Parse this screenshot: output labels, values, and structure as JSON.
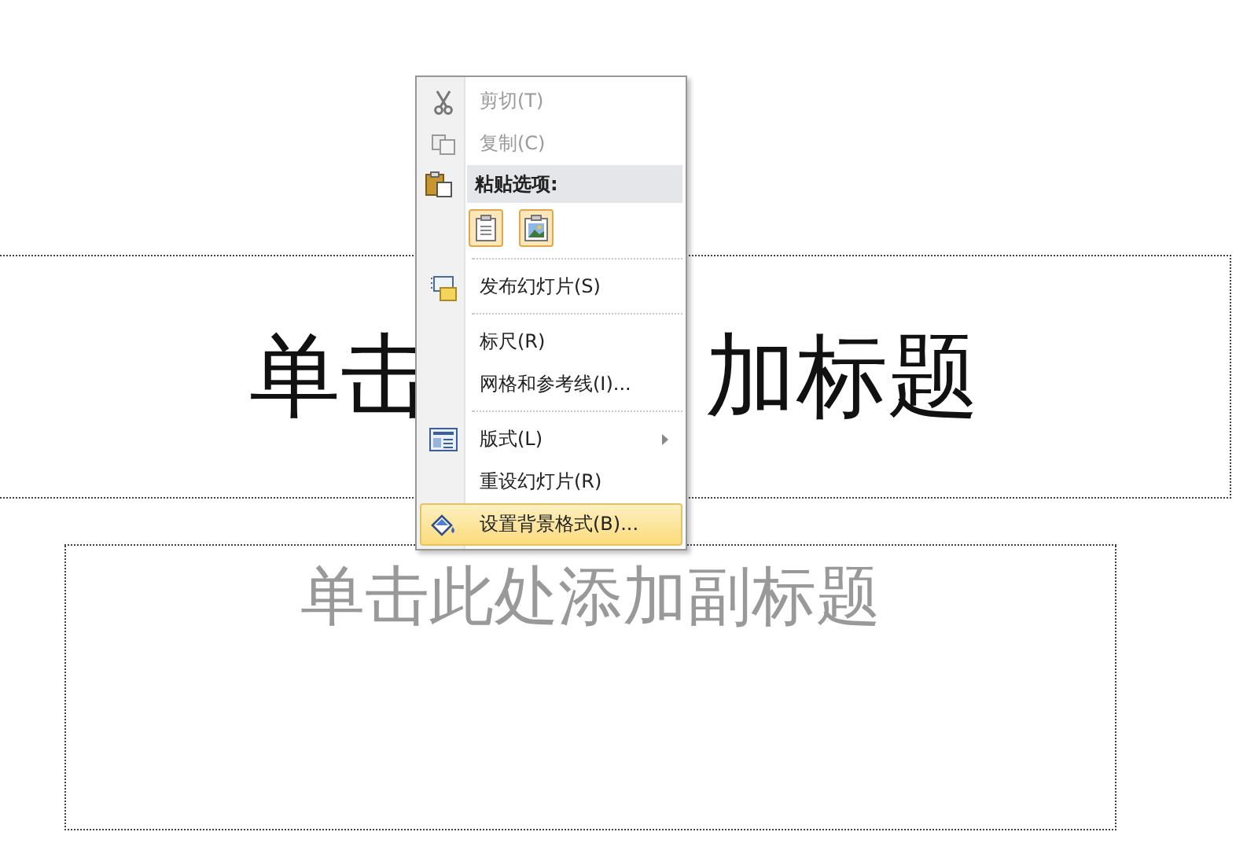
{
  "title_placeholder": {
    "visible_parts": [
      "单击",
      "加标题"
    ]
  },
  "subtitle_placeholder": {
    "text": "单击此处添加副标题"
  },
  "context_menu": {
    "items": [
      {
        "kind": "item",
        "label": "剪切(T)",
        "disabled": true,
        "selected": false,
        "submenu": false
      },
      {
        "kind": "item",
        "label": "复制(C)",
        "disabled": true,
        "selected": false,
        "submenu": false
      },
      {
        "kind": "header",
        "label": "粘贴选项:"
      },
      {
        "kind": "paste_options"
      },
      {
        "kind": "separator"
      },
      {
        "kind": "item",
        "label": "发布幻灯片(S)",
        "disabled": false,
        "selected": false,
        "submenu": false
      },
      {
        "kind": "separator"
      },
      {
        "kind": "item",
        "label": "标尺(R)",
        "disabled": false,
        "selected": false,
        "submenu": false
      },
      {
        "kind": "item",
        "label": "网格和参考线(I)...",
        "disabled": false,
        "selected": false,
        "submenu": false
      },
      {
        "kind": "separator"
      },
      {
        "kind": "item",
        "label": "版式(L)",
        "disabled": false,
        "selected": false,
        "submenu": true
      },
      {
        "kind": "item",
        "label": "重设幻灯片(R)",
        "disabled": false,
        "selected": false,
        "submenu": false
      },
      {
        "kind": "item",
        "label": "设置背景格式(B)...",
        "disabled": false,
        "selected": true,
        "submenu": false
      }
    ]
  }
}
